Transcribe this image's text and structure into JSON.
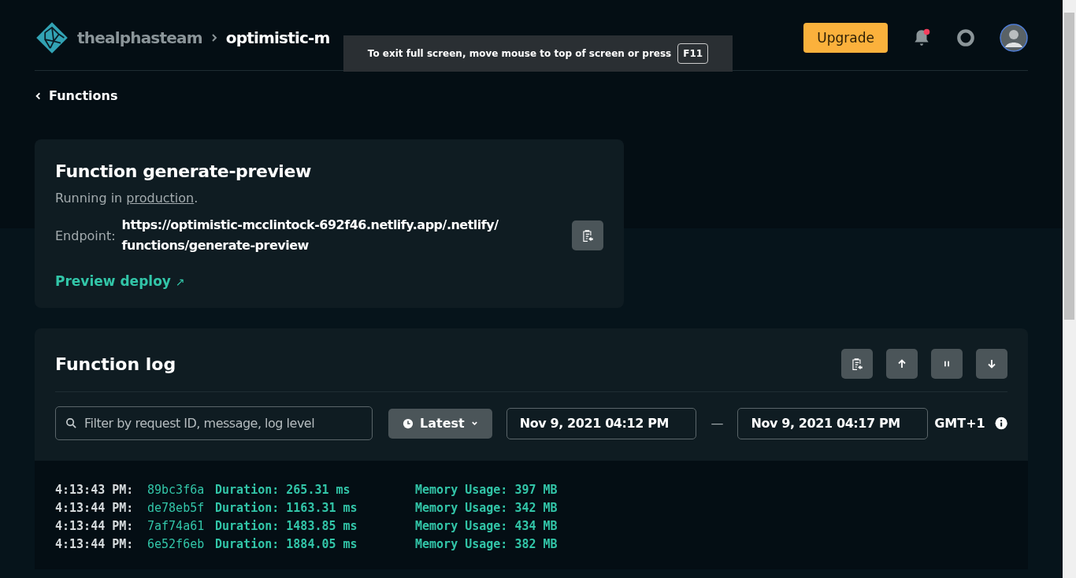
{
  "header": {
    "team": "thealphasteam",
    "site": "optimistic-m",
    "upgrade_button": "Upgrade",
    "notifications": {
      "unread": true
    }
  },
  "fullscreen_notice": {
    "text": "To exit full screen, move mouse to top of screen or press",
    "key": "F11"
  },
  "back_link": "Functions",
  "function_card": {
    "title": "Function generate-preview",
    "status_prefix": "Running in",
    "status_link": "production",
    "status_suffix": ".",
    "endpoint_label": "Endpoint:",
    "endpoint": "https://optimistic-mcclintock-692f46.netlify.app/.netlify/functions/generate-preview",
    "preview_link": "Preview deploy",
    "preview_icon": "↗"
  },
  "function_log": {
    "title": "Function log",
    "filter": {
      "placeholder": "Filter by request ID, message, log level"
    },
    "range_button": "Latest",
    "from": "Nov 9, 2021 04:12 PM",
    "separator": "—",
    "to": "Nov 9, 2021 04:17 PM",
    "timezone": "GMT+1",
    "entries": [
      {
        "time": "4:13:43 PM:",
        "request_id": "89bc3f6a",
        "duration": "Duration: 265.31 ms",
        "memory": "Memory Usage: 397 MB"
      },
      {
        "time": "4:13:44 PM:",
        "request_id": "de78eb5f",
        "duration": "Duration: 1163.31 ms",
        "memory": "Memory Usage: 342 MB"
      },
      {
        "time": "4:13:44 PM:",
        "request_id": "7af74a61",
        "duration": "Duration: 1483.85 ms",
        "memory": "Memory Usage: 434 MB"
      },
      {
        "time": "4:13:44 PM:",
        "request_id": "6e52f6eb",
        "duration": "Duration: 1884.05 ms",
        "memory": "Memory Usage: 382 MB"
      }
    ]
  }
}
